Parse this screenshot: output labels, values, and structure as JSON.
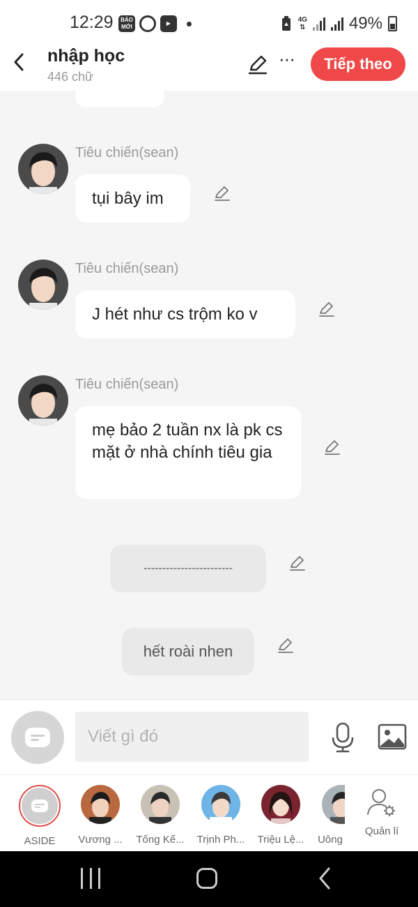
{
  "status_bar": {
    "time": "12:29",
    "app_badge": "BÁO MỚI",
    "network": "4G",
    "battery": "49%"
  },
  "header": {
    "title": "nhập học",
    "word_count": "446 chữ",
    "next_label": "Tiếp theo"
  },
  "messages": [
    {
      "sender": "Tiêu chiến(sean)",
      "text": "tụi bây im"
    },
    {
      "sender": "Tiêu chiến(sean)",
      "text": "J hét như cs trộm ko v"
    },
    {
      "sender": "Tiêu chiến(sean)",
      "text": "mẹ bảo 2 tuần nx là pk cs mặt ở nhà chính tiêu gia"
    }
  ],
  "narrations": [
    {
      "text": "------------------------"
    },
    {
      "text": "hết roài nhen"
    }
  ],
  "composer": {
    "placeholder": "Viết gì đó"
  },
  "characters": [
    {
      "name": "ASIDE"
    },
    {
      "name": "Vương ..."
    },
    {
      "name": "Tống Kế..."
    },
    {
      "name": "Trịnh Ph..."
    },
    {
      "name": "Triệu Lệ..."
    },
    {
      "name": "Uông"
    },
    {
      "name": "Quản lí"
    }
  ],
  "colors": {
    "accent": "#f04848",
    "background": "#f5f5f5",
    "bubble": "#ffffff",
    "narration_bubble": "#e9e9e9"
  }
}
